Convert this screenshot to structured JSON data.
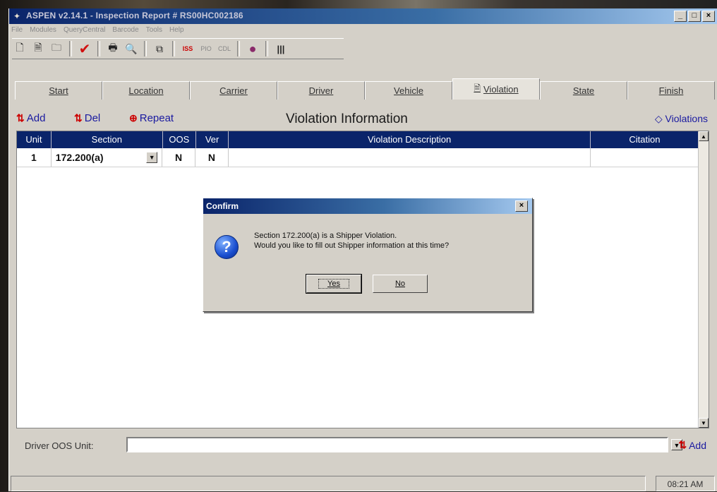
{
  "window": {
    "title": "ASPEN v2.14.1 - Inspection Report # RS00HC002186",
    "minimize": "_",
    "maximize": "□",
    "close": "×"
  },
  "menu": [
    "File",
    "Modules",
    "QueryCentral",
    "Barcode",
    "Tools",
    "Help"
  ],
  "toolbar": {
    "buttons": [
      {
        "name": "new-document-icon",
        "glyph": "🗋"
      },
      {
        "name": "open-document-icon",
        "glyph": "🗎"
      },
      {
        "name": "folder-icon",
        "glyph": "🗀"
      },
      {
        "name": "checkmark-icon",
        "glyph": "✔"
      },
      {
        "name": "printer-icon",
        "glyph": "🖶"
      },
      {
        "name": "print-preview-icon",
        "glyph": "🔍"
      },
      {
        "name": "copy-icon",
        "glyph": "⧉"
      },
      {
        "name": "iss-icon",
        "glyph": "ISS"
      },
      {
        "name": "pio-icon",
        "glyph": "PIO"
      },
      {
        "name": "cdl-icon",
        "glyph": "CDL"
      },
      {
        "name": "book-icon",
        "glyph": "●"
      },
      {
        "name": "barcode-icon",
        "glyph": "|||"
      }
    ]
  },
  "tabs": [
    {
      "label": "Start",
      "active": false
    },
    {
      "label": "Location",
      "active": false
    },
    {
      "label": "Carrier",
      "active": false
    },
    {
      "label": "Driver",
      "active": false
    },
    {
      "label": "Vehicle",
      "active": false
    },
    {
      "label": "Violation",
      "active": true
    },
    {
      "label": "State",
      "active": false
    },
    {
      "label": "Finish",
      "active": false
    }
  ],
  "actions": {
    "add": "Add",
    "del": "Del",
    "repeat": "Repeat",
    "title": "Violation Information",
    "violations_link": "Violations"
  },
  "grid": {
    "columns": [
      "Unit",
      "Section",
      "OOS",
      "Ver",
      "Violation Description",
      "Citation"
    ],
    "rows": [
      {
        "unit": "1",
        "section": "172.200(a)",
        "oos": "N",
        "ver": "N",
        "description": "",
        "citation": ""
      }
    ]
  },
  "dialog": {
    "title": "Confirm",
    "icon": "question-icon",
    "line1": "Section 172.200(a) is a Shipper Violation.",
    "line2": "Would you like to fill out Shipper information at this time?",
    "yes": "Yes",
    "no": "No"
  },
  "driver_oos": {
    "label": "Driver OOS Unit:",
    "value": "",
    "add": "Add"
  },
  "status": {
    "time": "08:21 AM"
  },
  "colors": {
    "titlebar": "#0a246a",
    "accent_link": "#1a1aa0",
    "face": "#d4d0c8"
  }
}
